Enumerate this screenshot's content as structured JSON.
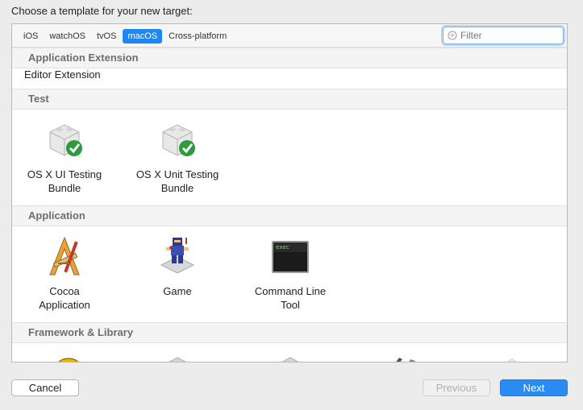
{
  "prompt": "Choose a template for your new target:",
  "tabs": [
    {
      "label": "iOS",
      "active": false
    },
    {
      "label": "watchOS",
      "active": false
    },
    {
      "label": "tvOS",
      "active": false
    },
    {
      "label": "macOS",
      "active": true
    },
    {
      "label": "Cross-platform",
      "active": false
    }
  ],
  "filter": {
    "placeholder": "Filter",
    "value": ""
  },
  "sections": {
    "app_extension": {
      "title": "Application Extension",
      "items": [
        "Editor Extension"
      ]
    },
    "test": {
      "title": "Test",
      "items": [
        {
          "line1": "OS X UI Testing",
          "line2": "Bundle"
        },
        {
          "line1": "OS X Unit Testing",
          "line2": "Bundle"
        }
      ]
    },
    "application": {
      "title": "Application",
      "items": [
        {
          "line1": "Cocoa",
          "line2": "Application"
        },
        {
          "line1": "Game",
          "line2": ""
        },
        {
          "line1": "Command Line",
          "line2": "Tool"
        }
      ]
    },
    "framework": {
      "title": "Framework & Library"
    }
  },
  "icon_text": {
    "terminal": "exec"
  },
  "buttons": {
    "cancel": "Cancel",
    "previous": "Previous",
    "next": "Next"
  },
  "colors": {
    "accent": "#1f87f1",
    "check": "#2e9a3e"
  }
}
